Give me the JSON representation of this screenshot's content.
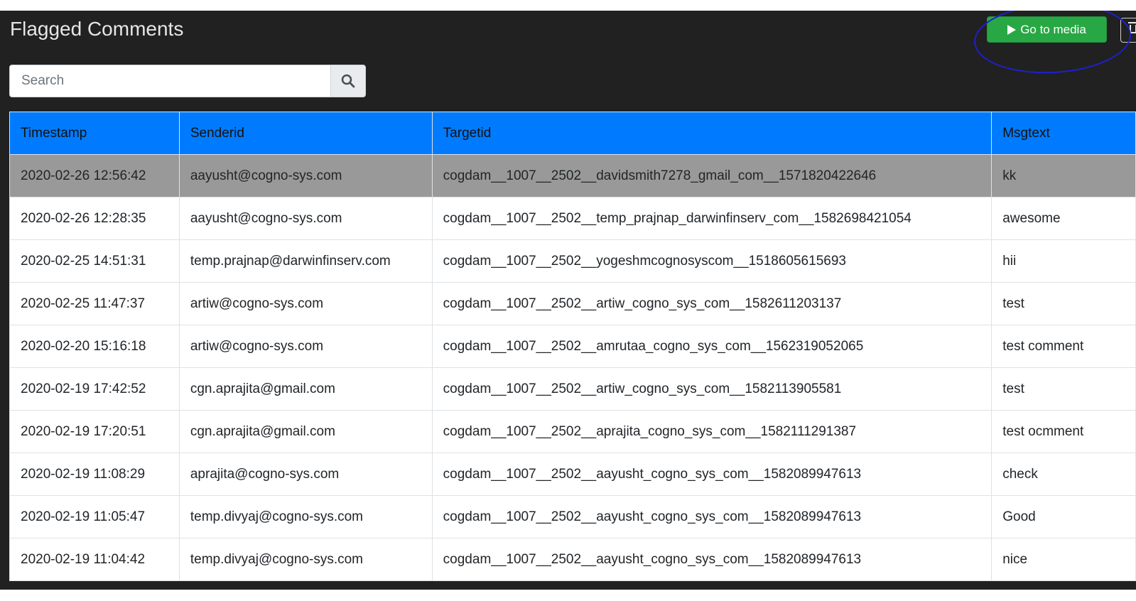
{
  "header": {
    "title": "Flagged Comments",
    "go_to_media_label": "Go to media"
  },
  "icons": {
    "play": "play-icon",
    "delete": "trash-icon",
    "search": "search-icon"
  },
  "search": {
    "placeholder": "Search",
    "value": ""
  },
  "colors": {
    "background": "#212121",
    "header_row": "#007bff",
    "selected_row": "#999999",
    "go_button": "#28a745",
    "annotation": "#1f1fd1"
  },
  "table": {
    "columns": [
      "Timestamp",
      "Senderid",
      "Targetid",
      "Msgtext"
    ],
    "rows": [
      [
        "2020-02-26 12:56:42",
        "aayusht@cogno-sys.com",
        "cogdam__1007__2502__davidsmith7278_gmail_com__1571820422646",
        "kk"
      ],
      [
        "2020-02-26 12:28:35",
        "aayusht@cogno-sys.com",
        "cogdam__1007__2502__temp_prajnap_darwinfinserv_com__1582698421054",
        "awesome"
      ],
      [
        "2020-02-25 14:51:31",
        "temp.prajnap@darwinfinserv.com",
        "cogdam__1007__2502__yogeshmcognosyscom__1518605615693",
        "hii"
      ],
      [
        "2020-02-25 11:47:37",
        "artiw@cogno-sys.com",
        "cogdam__1007__2502__artiw_cogno_sys_com__1582611203137",
        "test"
      ],
      [
        "2020-02-20 15:16:18",
        "artiw@cogno-sys.com",
        "cogdam__1007__2502__amrutaa_cogno_sys_com__1562319052065",
        "test comment"
      ],
      [
        "2020-02-19 17:42:52",
        "cgn.aprajita@gmail.com",
        "cogdam__1007__2502__artiw_cogno_sys_com__1582113905581",
        "test"
      ],
      [
        "2020-02-19 17:20:51",
        "cgn.aprajita@gmail.com",
        "cogdam__1007__2502__aprajita_cogno_sys_com__1582111291387",
        "test ocmment"
      ],
      [
        "2020-02-19 11:08:29",
        "aprajita@cogno-sys.com",
        "cogdam__1007__2502__aayusht_cogno_sys_com__1582089947613",
        "check"
      ],
      [
        "2020-02-19 11:05:47",
        "temp.divyaj@cogno-sys.com",
        "cogdam__1007__2502__aayusht_cogno_sys_com__1582089947613",
        "Good"
      ],
      [
        "2020-02-19 11:04:42",
        "temp.divyaj@cogno-sys.com",
        "cogdam__1007__2502__aayusht_cogno_sys_com__1582089947613",
        "nice"
      ]
    ],
    "selected_row": 0
  }
}
